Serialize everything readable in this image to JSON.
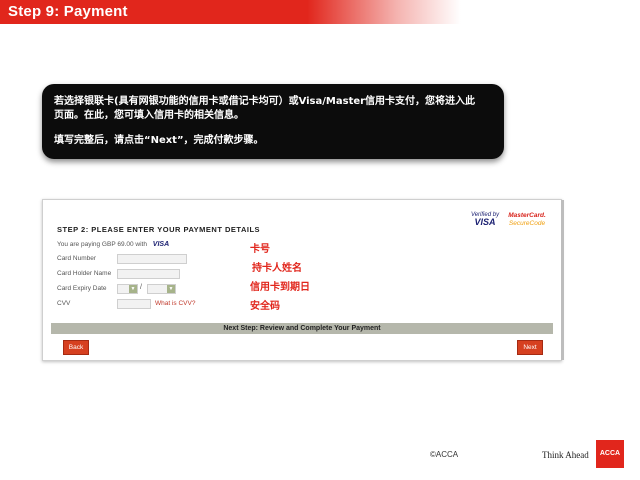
{
  "header": {
    "title": "Step 9: Payment"
  },
  "callout": {
    "line1": "若选择银联卡(具有网银功能的信用卡或借记卡均可）或Visa/Master信用卡支付，您将进入此",
    "line2": "页面。在此，您可填入信用卡的相关信息。",
    "line3": "填写完整后，请点击“Next”，完成付款步骤。"
  },
  "payment_form": {
    "step_title": "STEP 2: PLEASE ENTER YOUR PAYMENT DETAILS",
    "paying_text": "You are paying GBP 69.00 with",
    "paying_card": "VISA",
    "logos": {
      "vbv_top": "Verified by",
      "vbv_main": "VISA",
      "mc_top": "MasterCard.",
      "mc_main": "SecureCode"
    },
    "fields": {
      "card_number_label": "Card Number",
      "holder_name_label": "Card Holder Name",
      "expiry_label": "Card Expiry Date",
      "expiry_separator": "/",
      "cvv_label": "CVV",
      "cvv_help_link": "What is CVV?"
    },
    "next_step_bar": "Next Step: Review and Complete Your Payment",
    "back_button": "Back",
    "next_button": "Next"
  },
  "annotations": {
    "card_number": "卡号",
    "holder_name": "持卡人姓名",
    "expiry": "信用卡到期日",
    "cvv": "安全码"
  },
  "footer": {
    "copyright": "©ACCA",
    "tagline": "Think Ahead",
    "logo_text": "ACCA"
  },
  "colors": {
    "accent_red": "#e1261c",
    "bar_grey": "#b5b7ab"
  }
}
